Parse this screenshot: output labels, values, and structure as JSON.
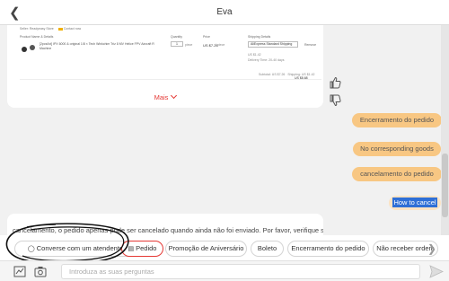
{
  "header": {
    "title": "Eva",
    "back_icon": "back-arrow-icon"
  },
  "order_card": {
    "seller": "Seller: Readyeasy Store",
    "contact": "Contact now",
    "columns": [
      "Product Name & Details",
      "Quantity",
      "Price",
      "Shipping Details"
    ],
    "product_title": "[2pcs/lot] IPX 6000 & original 1/8 × Tech Winkchim Triz 8 MV Helice FPV Aircraft R Machine",
    "quantity": "1",
    "quantity_unit": "piece",
    "price": "US $7.26",
    "price_unit": "/ piece",
    "shipping_method": "AliExpress Standard Shipping",
    "remove": "Remove",
    "shipping_cost": "US $1.42",
    "delivery_time": "Delivery Time: 20-40 days",
    "subtotal": "Subtotal: US $7.26",
    "shipping_total": "Shipping: US $1.42",
    "total": "US $8.68",
    "mais": "Mais"
  },
  "feedback": {
    "like_icon": "thumbs-up-icon",
    "dislike_icon": "thumbs-down-icon"
  },
  "messages": {
    "user": [
      "Encerramento do pedido",
      "No corresponding goods",
      "cancelamento do pedido",
      "How to cancel"
    ],
    "bot_partial": "cancelamento, o pedido apenas pode ser cancelado quando ainda não foi enviado. Por favor, verifique se"
  },
  "quick_replies": [
    {
      "label": "Converse com um atendente",
      "icon": "chat-bubble-icon"
    },
    {
      "label": "Pedido",
      "icon": "order-icon"
    },
    {
      "label": "Promoção de Aniversário"
    },
    {
      "label": "Boleto"
    },
    {
      "label": "Encerramento do pedido"
    },
    {
      "label": "Não receber ordem"
    }
  ],
  "input": {
    "placeholder": "Introduza as suas perguntas"
  },
  "colors": {
    "accent": "#e53935",
    "user_bubble": "#f8c783",
    "selection": "#2f6fd6"
  }
}
